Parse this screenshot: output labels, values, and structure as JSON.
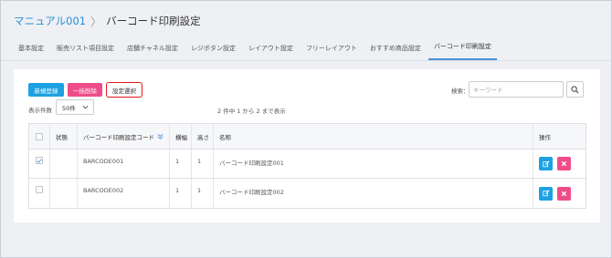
{
  "breadcrumb": {
    "parent": "マニュアル001",
    "separator": "〉",
    "current": "バーコード印刷設定"
  },
  "tabs": [
    {
      "label": "基本設定"
    },
    {
      "label": "販売リスト項目設定"
    },
    {
      "label": "店舗チャネル設定"
    },
    {
      "label": "レジボタン設定"
    },
    {
      "label": "レイアウト設定"
    },
    {
      "label": "フリーレイアウト"
    },
    {
      "label": "おすすめ商品設定"
    },
    {
      "label": "バーコード印刷設定",
      "active": true
    }
  ],
  "toolbar": {
    "new_label": "新規登録",
    "bulk_delete_label": "一括削除",
    "settings_label": "設定選択"
  },
  "search": {
    "label": "検索：",
    "placeholder": "キーワード"
  },
  "pagination": {
    "count_label": "表示件数",
    "count_value": "50件",
    "summary": "2 件中 1 から 2 まで表示"
  },
  "table": {
    "headers": {
      "status": "状態",
      "code": "バーコード印刷設定コード",
      "width": "横幅",
      "height": "高さ",
      "name": "名称",
      "ops": "操作"
    },
    "rows": [
      {
        "checked": true,
        "status": "",
        "code": "BARCODE001",
        "width": "1",
        "height": "1",
        "name": "バーコード印刷設定001"
      },
      {
        "checked": false,
        "status": "",
        "code": "BARCODE002",
        "width": "1",
        "height": "1",
        "name": "バーコード印刷設定002"
      }
    ]
  },
  "colors": {
    "accent_blue": "#1da1e2",
    "accent_pink": "#ef4d8a",
    "highlight_red": "#e01818"
  }
}
